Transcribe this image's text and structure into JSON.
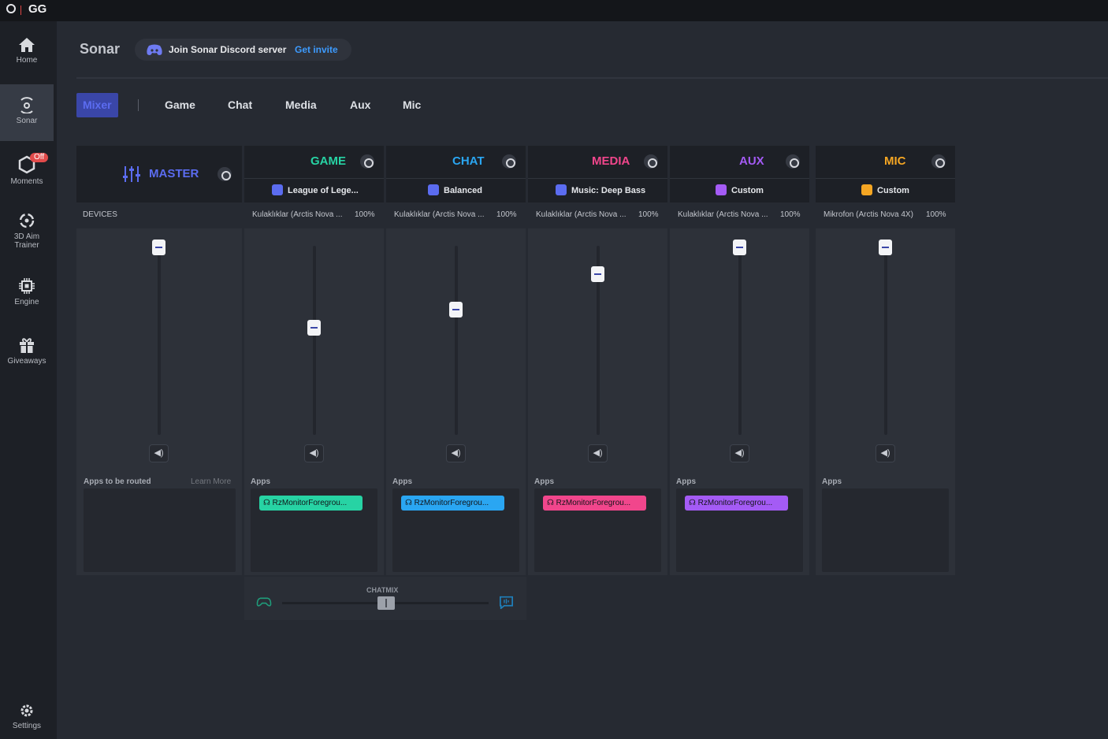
{
  "app": {
    "title": "GG"
  },
  "nav": {
    "home": "Home",
    "sonar": "Sonar",
    "moments": "Moments",
    "moments_badge": "Off",
    "aim_line1": "3D Aim",
    "aim_line2": "Trainer",
    "engine": "Engine",
    "giveaways": "Giveaways",
    "settings": "Settings"
  },
  "header": {
    "title": "Sonar",
    "discord_text": "Join Sonar Discord server",
    "discord_link": "Get invite"
  },
  "tabs": [
    "Mixer",
    "Game",
    "Chat",
    "Media",
    "Aux",
    "Mic"
  ],
  "active_tab": "Mixer",
  "master": {
    "name": "MASTER",
    "devices_label": "DEVICES",
    "apps_label": "Apps to be routed",
    "learn_more": "Learn More",
    "volume": 1.0
  },
  "channels": [
    {
      "id": "game",
      "name": "GAME",
      "color": "#27d3a4",
      "preset": "League of Lege...",
      "preset_color": "#5b6cf0",
      "device": "Kulaklıklar (Arctis Nova ...",
      "pct": "100%",
      "apps_label": "Apps",
      "app": "RzMonitorForegrou...",
      "volume": 0.57
    },
    {
      "id": "chat",
      "name": "CHAT",
      "color": "#2aa6f2",
      "preset": "Balanced",
      "preset_color": "#5b6cf0",
      "device": "Kulaklıklar (Arctis Nova ...",
      "pct": "100%",
      "apps_label": "Apps",
      "app": "RzMonitorForegrou...",
      "volume": 0.66
    },
    {
      "id": "media",
      "name": "MEDIA",
      "color": "#f1468c",
      "preset": "Music: Deep Bass",
      "preset_color": "#5b6cf0",
      "device": "Kulaklıklar (Arctis Nova ...",
      "pct": "100%",
      "apps_label": "Apps",
      "app": "RzMonitorForegrou...",
      "volume": 0.86
    },
    {
      "id": "aux",
      "name": "AUX",
      "color": "#a45bf5",
      "preset": "Custom",
      "preset_color": "#a45bf5",
      "device": "Kulaklıklar (Arctis Nova ...",
      "pct": "100%",
      "apps_label": "Apps",
      "app": "RzMonitorForegrou...",
      "volume": 1.0
    },
    {
      "id": "mic",
      "name": "MIC",
      "color": "#f5a623",
      "preset": "Custom",
      "preset_color": "#f5a623",
      "device": "Mikrofon (Arctis Nova 4X)",
      "pct": "100%",
      "apps_label": "Apps",
      "app": "",
      "volume": 1.0
    }
  ],
  "chatmix": {
    "label": "CHATMIX",
    "balance": 0.5
  }
}
